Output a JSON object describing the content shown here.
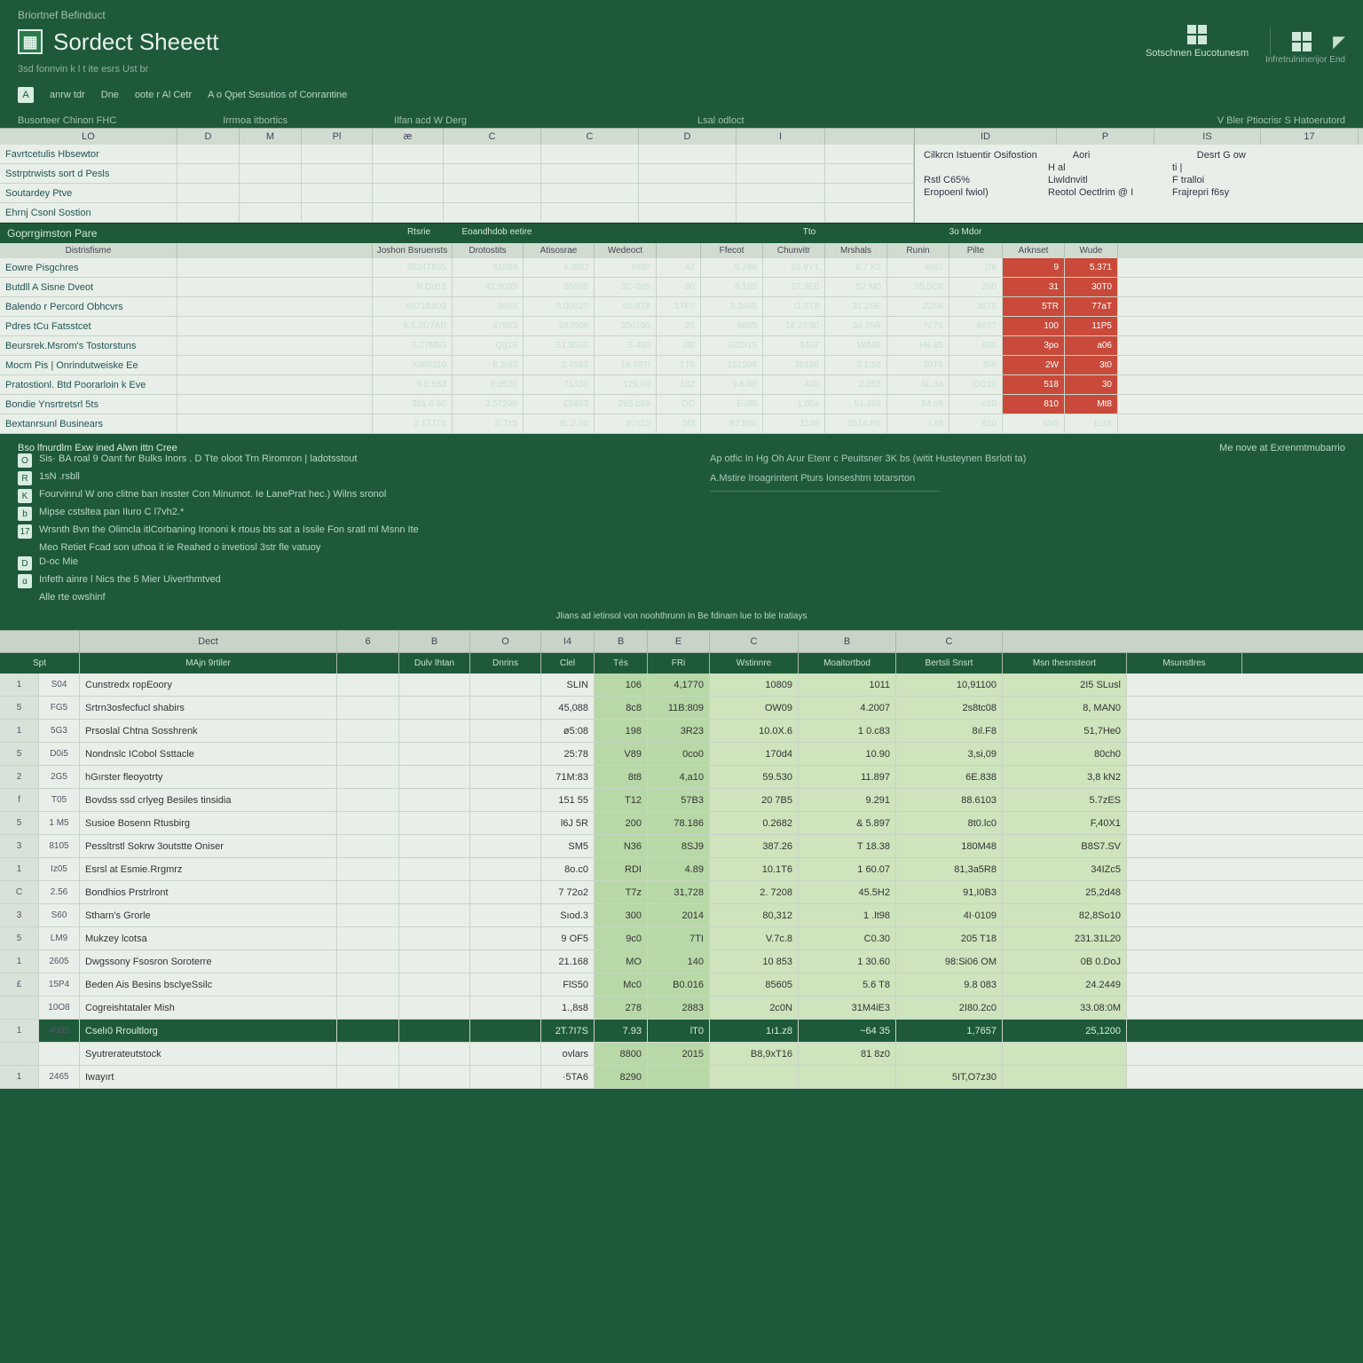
{
  "header": {
    "top_label": "Briortnef Befinduct",
    "app_title": "Sordect Sheeett",
    "right_groups": [
      {
        "label": "Sotschnen Eucotunesm"
      },
      {
        "label": ""
      },
      {
        "label": ""
      }
    ],
    "right_caption": "Infretrulninerijor End",
    "subtitle": "3sd fonnvin k l t ite esrs   Ust br",
    "toolbar": [
      {
        "icon": "A",
        "label": "anrw tdr"
      },
      {
        "label": "Dne"
      },
      {
        "label": "oote r Al Cetr"
      },
      {
        "label": "A o Qpet Sesutios of Conrantine"
      }
    ],
    "panel_labels": {
      "left": "Busorteer Chinon FHC",
      "mid1": "Irrmoa itbortics",
      "mid2": "Ilfan acd W Derg",
      "center": "Lsal odloct",
      "right": "V Bler Ptiocrisr S Hatoerutord"
    }
  },
  "upper_grid": {
    "left_cols": [
      "LO",
      "D",
      "M",
      "Pl",
      "æ",
      "C",
      "C",
      "D",
      "I"
    ],
    "left_rows": [
      "Favrtcetulis Hbsewtor",
      "Sstrptrwists sort d Pesls",
      "Soutardey Ptve",
      "Ehrnj Csonl Sostion"
    ],
    "right_cols": [
      "ID",
      "P",
      "IS",
      "17"
    ],
    "info": [
      {
        "a": "Cilkrcn Istuentir Osifostion",
        "b": "Aori",
        "c": "Desrt G ow"
      },
      {
        "a": "",
        "b": "H al",
        "c": "ti |"
      },
      {
        "a": "Rstl C65%",
        "b": "Liwldnvitl",
        "c": "F tralloi"
      },
      {
        "a": "Eropoenl fwiol)",
        "b": "Reotol Oectlrim @ I",
        "c": "Frajrepri f6sy"
      }
    ]
  },
  "mid_table": {
    "title_left": "Goprrgimston Pare",
    "title_cols": [
      "Rtsrie",
      "Eoandhdob eetire",
      "",
      "",
      "",
      "Tto",
      "",
      "3o Mdor",
      "",
      ""
    ],
    "sub_left": "Distrisfisme",
    "sub_cols": [
      "Joshon Bsruensts",
      "Drotostits",
      "Atisosrae",
      "Wedeoct",
      "",
      "Ffecot",
      "Chunvitr",
      "Mrshals",
      "Runin",
      "Pilte",
      "Arknset",
      "Wude"
    ],
    "rows": [
      {
        "label": "Eowre Pisgchres",
        "v": [
          "3534T835",
          "91888",
          "4·3BD",
          "6s80",
          "42",
          "S.788",
          "19.9Y1",
          "8.7 K5",
          "9s83",
          "2f8",
          "9",
          "5.371"
        ],
        "red": [
          10,
          11
        ]
      },
      {
        "label": "Butdll A Sisne Dveot",
        "v": [
          "N.Dd13",
          "42:8085",
          "86080",
          "3C·085",
          "60",
          "8.188",
          "27.3E0",
          "S2 M0",
          "85,5C8",
          "260",
          "31",
          "30T0"
        ],
        "red": [
          10,
          11
        ]
      },
      {
        "label": "Balendo r Percord Obhcvrs",
        "v": [
          "6671B803",
          "9868",
          "8.00627",
          "60.8T8",
          "17F7",
          "9.3s68",
          "I1.6T8",
          "31.2SE",
          "22F8",
          "36T6",
          "5TR",
          "77aT"
        ],
        "red": [
          10,
          11
        ]
      },
      {
        "label": "Pdres tCu Fatsstcet",
        "v": [
          "6.5.0D7AB",
          "87963",
          "282009",
          "350190",
          "25",
          "9895",
          "14.23'80",
          "34.25R",
          "N.78",
          "8637",
          "100",
          "11P5"
        ],
        "red": [
          10,
          11
        ]
      },
      {
        "label": "Beursrek.Msrom's Tostorstuns",
        "v": [
          "5,27M83",
          "Qg19",
          "S1 9560",
          "S 460",
          "0l6",
          "GcDl15",
          "3407",
          "WA48",
          "Ha 85",
          "690",
          "3po",
          "a06"
        ],
        "red": [
          10,
          11
        ]
      },
      {
        "label": "Mocm Pis | Onrindutweiske Ee",
        "v": [
          "X089110",
          "8,3nt3",
          "2.4563",
          "16.70TI",
          "1T6",
          "151598",
          "35158",
          "3 1.58",
          "30T6",
          "SI8",
          "2W",
          "3t0"
        ],
        "red": [
          10,
          11
        ]
      },
      {
        "label": "Pratostionl. Btd Poorarloin k Eve",
        "v": [
          "9 0:583",
          "8:8530",
          "71450",
          "129,60",
          "182",
          "9.6.88",
          "495",
          "2.058",
          "6L.38",
          "GO10",
          "518",
          "30"
        ],
        "red": [
          10,
          11
        ]
      },
      {
        "label": "Bondie Ynsrtretsrl 5ts",
        "v": [
          "351 6:60",
          "3:57290",
          "£5883",
          "265.b69",
          "DD",
          "Es80",
          "1.05s",
          "51.468",
          "84 o8",
          "610",
          "810",
          "Mt8"
        ],
        "red": [
          10,
          11
        ]
      },
      {
        "label": "Bextanrsunl Businears",
        "v": [
          "3.17J7S",
          "3'.7z5",
          "8L 2.08",
          "8; c10",
          "5I3",
          "82.550",
          ".1148",
          "3S14.R8",
          "I s8",
          "610",
          "Ns0",
          "Ei18"
        ],
        "red": []
      }
    ],
    "foot_left": "Bso lfnurdlm Exw ined Alwn ittn Cree",
    "foot_right": "Me nove at Exrenmtmubarrio"
  },
  "notes": {
    "left": [
      {
        "icon": "O",
        "text": "Sis· BA roal 9 Oant fvr Bulks Inors . D Tte oloot Trn Riromron  | ladotsstout"
      },
      {
        "icon": "R",
        "text": "1sN .rsbll"
      },
      {
        "icon": "K",
        "text": "Fourvinrul W ono clitne ban insster Con Minumot. Ie LanePrat hec.) Wilns sronol"
      },
      {
        "icon": "b",
        "text": "Mipse cstsltea pan Iluro C l7vh2.*"
      },
      {
        "icon": "17",
        "text": "Wrsnth Bvn the Olimcla itlCorbaning Irononi k rtous bts sat a Issile Fon sratl ml Msnn Ite"
      },
      {
        "icon": "",
        "text": "Meo Retiet Fcad son uthoa it ie Reahed o invetiosl 3str fle vatuoy"
      },
      {
        "icon": "D",
        "text": "D-oc Mie"
      },
      {
        "icon": "α",
        "text": "Infeth ainre l Nics the 5 Mier  Uiverthmtved"
      },
      {
        "icon": "",
        "text": "Alle rte owshinf"
      }
    ],
    "center": "Jlians ad ietinsol von noohthrunn In Be fdinam lue to ble Iratiays",
    "right": [
      "Ap otfic In Hg Oh Arur Etenr c Peuitsner 3K bs (witit Husteynen Bsrloti ta)",
      "A.Mstire Iroagrintent Pturs Ionseshtm totarsrton"
    ]
  },
  "lower_grid": {
    "head": [
      "",
      "Dect",
      "6",
      "B",
      "O",
      "I4",
      "B",
      "E",
      "C",
      "B",
      "C"
    ],
    "subhead": [
      "Spt",
      "MAjn 9rtiler",
      "",
      "Dulv Ihtan",
      "Dnrins",
      "Clel",
      "Tés",
      "FRi",
      "Wstinnre",
      "Moaitortbod",
      "Bertsli Snsrt",
      "Msn thesnsteort",
      "Msunstlres"
    ],
    "rows": [
      {
        "n": "1",
        "id": "S04",
        "label": "Cunstredx ropEoory",
        "v": [
          "",
          "",
          "",
          "SLIN",
          "106",
          "4,1770",
          "10809",
          "1011",
          "10,91100",
          "2I5 SLusl"
        ]
      },
      {
        "n": "5",
        "id": "FG5",
        "label": "Srtrn3osfecfucl shabirs",
        "v": [
          "",
          "",
          "",
          "45,088",
          "8c8",
          "11B:809",
          "OW09",
          "4.2007",
          "2s8tc08",
          "8, MAN0"
        ]
      },
      {
        "n": "1",
        "id": "5G3",
        "label": "Prsoslal Chtna Sosshrenk",
        "v": [
          "",
          "",
          "",
          "ø5:08",
          "198",
          "3R23",
          "10.0X.6",
          "1 0.c83",
          "8ıl.F8",
          "51,7He0"
        ]
      },
      {
        "n": "5",
        "id": "D0i5",
        "label": "Nondnslc ICobol Ssttacle",
        "v": [
          "",
          "",
          "",
          "25:78",
          "V89",
          "0co0",
          "170d4",
          "10.90",
          "3,si,09",
          "80ch0"
        ]
      },
      {
        "n": "2",
        "id": "2G5",
        "label": "hGırster fleoyotrty",
        "v": [
          "",
          "",
          "",
          "71M:83",
          "8t8",
          "4,a10",
          "59.530",
          "11.897",
          "6E.838",
          "3,8 kN2"
        ]
      },
      {
        "n": "f",
        "id": "Т05",
        "label": "Bovdss ssd crlyeg Besiles tinsidia",
        "v": [
          "",
          "",
          "",
          "151 55",
          "T12",
          "57B3",
          "20 7B5",
          "9.291",
          "88.6103",
          "5.7zES"
        ]
      },
      {
        "n": "5",
        "id": "1 M5",
        "label": "Susioe Bosenn Rtusbirg",
        "v": [
          "",
          "",
          "",
          "l6J 5R",
          "200",
          "78.186",
          "0.2682",
          "& 5.897",
          "8t0.lc0",
          "F,40X1"
        ]
      },
      {
        "n": "3",
        "id": "8105",
        "label": "Pessltrstl Sokrw 3outstte Oniser",
        "v": [
          "",
          "",
          "",
          "SM5",
          "N36",
          "8SJ9",
          "387.26",
          "T 18.38",
          "180M48",
          "B8S7.SV"
        ]
      },
      {
        "n": "1",
        "id": "Iz05",
        "label": "Esrsl at Esmie.Rrgmrz",
        "v": [
          "",
          "",
          "",
          "8o.c0",
          "RDI",
          "4.89",
          "10.1T6",
          "1 60.07",
          "81,3a5R8",
          "34IZc5"
        ]
      },
      {
        "n": "C",
        "id": "2.56",
        "label": "Bondhios Prstrlront",
        "v": [
          "",
          "",
          "",
          "7 72o2",
          "T7z",
          "31,728",
          "2. 7208",
          "45.5H2",
          "91,I0B3",
          "25,2d48"
        ]
      },
      {
        "n": "3",
        "id": "S60",
        "label": "Stharn's Grorle",
        "v": [
          "",
          "",
          "",
          "Sıod.3",
          "300",
          "2014",
          "80,312",
          "1 .lt98",
          "4I·0109",
          "82,8So10"
        ]
      },
      {
        "n": "5",
        "id": "LM9",
        "label": "Mukzey lcotsa",
        "v": [
          "",
          "",
          "",
          "9 OF5",
          "9c0",
          "7TI",
          "V.7c.8",
          "C0.30",
          "205 T18",
          "231.31L20"
        ]
      },
      {
        "n": "1",
        "id": "2605",
        "label": "Dwgssony Fsosron Soroterre",
        "v": [
          "",
          "",
          "",
          "21.168",
          "MO",
          "140",
          "10 853",
          "1 30.60",
          "98:Si06 OM",
          "0B 0.DoJ"
        ]
      },
      {
        "n": "£",
        "id": "15P4",
        "label": "Beden Ais Besins bsclyeSsilc",
        "v": [
          "",
          "",
          "",
          "FlS50",
          "Mc0",
          "B0.016",
          "85605",
          "5.6 T8",
          "9.8 083",
          "24.2449"
        ]
      },
      {
        "n": "",
        "id": "10O8",
        "label": "Cogreishtataler Mish",
        "v": [
          "",
          "",
          "",
          "1.,8s8",
          "278",
          "2883",
          "2c0N",
          "31M4iE3",
          "2I80.2c0",
          "33.08:0M"
        ]
      },
      {
        "n": "1",
        "id": "40d5",
        "label": "Cselı0 Rroultlorg",
        "v": [
          "",
          "",
          "",
          "2T.7I7S",
          "7.93",
          "lT0",
          "1ı1.z8",
          "~64 35",
          "1,7657",
          "25,1200"
        ],
        "sel": true
      },
      {
        "n": "",
        "id": "",
        "label": "Syutrerateutstock",
        "v": [
          "",
          "",
          "",
          "ovlars",
          "8800",
          "2015",
          "B8,9xT16",
          "81 8z0",
          "",
          ""
        ]
      },
      {
        "n": "1",
        "id": "2465",
        "label": "Iwayırt",
        "v": [
          "",
          "",
          "",
          "·5TA6",
          "8290",
          "",
          "",
          "",
          "5IT,O7z30",
          ""
        ]
      }
    ]
  }
}
